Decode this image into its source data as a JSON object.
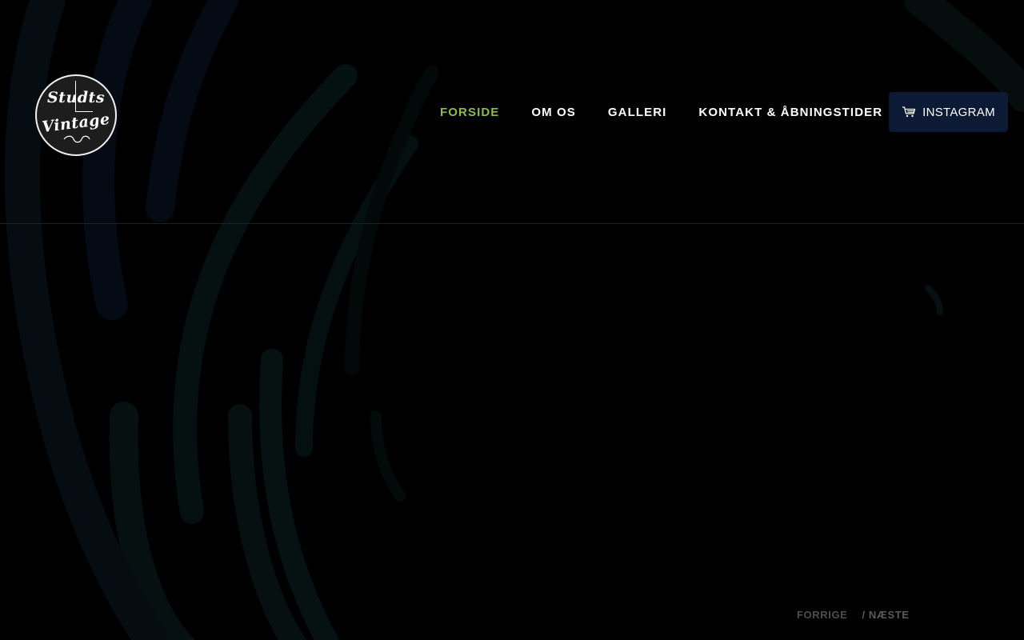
{
  "brand": {
    "logo_line1": "Studts",
    "logo_line2": "Vintage"
  },
  "nav": {
    "items": [
      {
        "label": "FORSIDE",
        "active": true
      },
      {
        "label": "OM OS",
        "active": false
      },
      {
        "label": "GALLERI",
        "active": false
      },
      {
        "label": "KONTAKT & ÅBNINGSTIDER",
        "active": false
      }
    ]
  },
  "cta": {
    "label": "INSTAGRAM",
    "icon": "cart-icon"
  },
  "slider": {
    "prev_label": "FORRIGE",
    "next_label": "/ NÆSTE"
  },
  "colors": {
    "background": "#000000",
    "active_nav": "#8cbc4f",
    "cta_background": "#0c1a36",
    "text": "#ffffff"
  }
}
